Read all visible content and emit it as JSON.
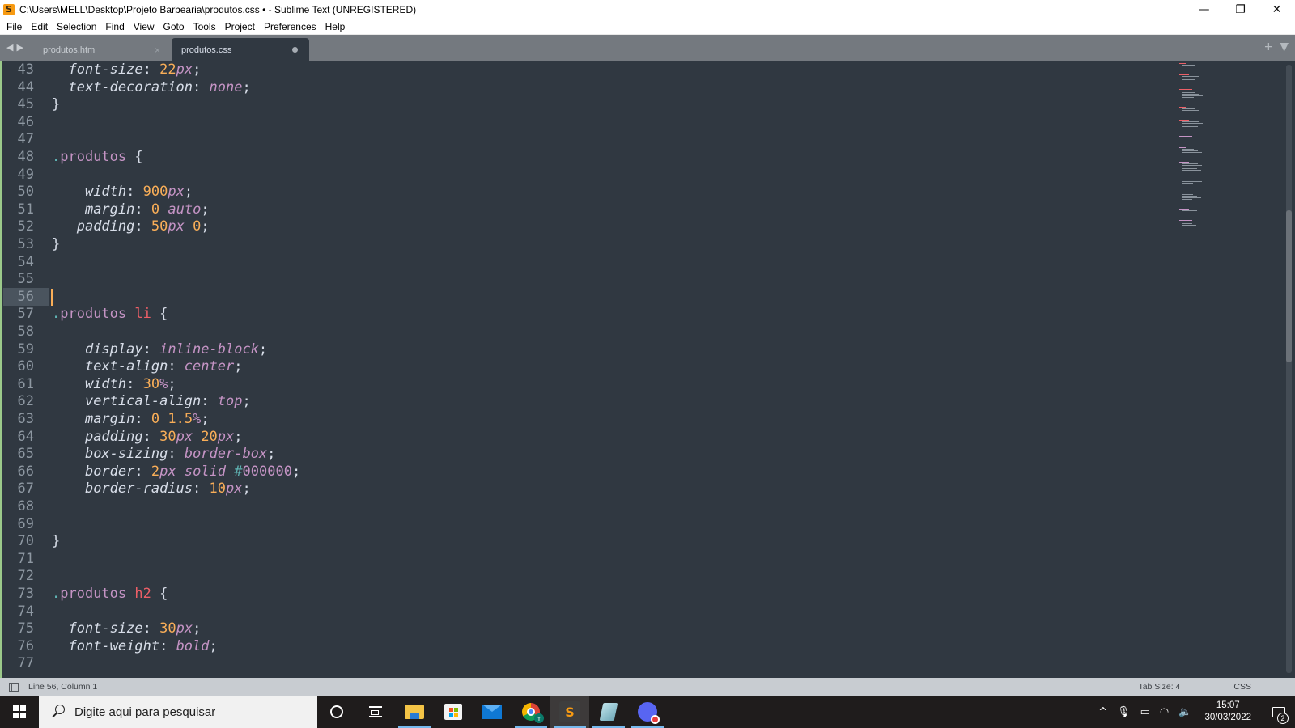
{
  "window": {
    "title": "C:\\Users\\MELL\\Desktop\\Projeto Barbearia\\produtos.css • - Sublime Text (UNREGISTERED)",
    "app_icon_glyph": "S",
    "controls": {
      "minimize": "—",
      "restore": "❐",
      "close": "✕"
    }
  },
  "menu": [
    "File",
    "Edit",
    "Selection",
    "Find",
    "View",
    "Goto",
    "Tools",
    "Project",
    "Preferences",
    "Help"
  ],
  "tabs": {
    "nav_prev": "◀",
    "nav_next": "▶",
    "items": [
      {
        "label": "produtos.html",
        "active": false,
        "close": "×"
      },
      {
        "label": "produtos.css",
        "active": true,
        "dirty": true
      }
    ],
    "new_tab": "+",
    "tab_menu": "▼"
  },
  "editor": {
    "current_line": 56,
    "scroll_position": 0.32,
    "scroll_visible_fraction": 0.25,
    "lines": [
      {
        "n": "43",
        "tokens": [
          [
            "sp",
            "  "
          ],
          [
            "prop",
            "font-size"
          ],
          [
            "punc",
            ": "
          ],
          [
            "num",
            "22"
          ],
          [
            "unit",
            "px"
          ],
          [
            "punc",
            ";"
          ]
        ]
      },
      {
        "n": "44",
        "tokens": [
          [
            "sp",
            "  "
          ],
          [
            "prop",
            "text-decoration"
          ],
          [
            "punc",
            ": "
          ],
          [
            "kw",
            "none"
          ],
          [
            "punc",
            ";"
          ]
        ]
      },
      {
        "n": "45",
        "tokens": [
          [
            "punc",
            "}"
          ]
        ]
      },
      {
        "n": "46",
        "tokens": []
      },
      {
        "n": "47",
        "tokens": []
      },
      {
        "n": "48",
        "tokens": [
          [
            "dot",
            "."
          ],
          [
            "sel",
            "produtos"
          ],
          [
            "punc",
            " {"
          ]
        ]
      },
      {
        "n": "49",
        "tokens": []
      },
      {
        "n": "50",
        "tokens": [
          [
            "sp",
            "    "
          ],
          [
            "prop",
            "width"
          ],
          [
            "punc",
            ": "
          ],
          [
            "num",
            "900"
          ],
          [
            "unit",
            "px"
          ],
          [
            "punc",
            ";"
          ]
        ]
      },
      {
        "n": "51",
        "tokens": [
          [
            "sp",
            "    "
          ],
          [
            "prop",
            "margin"
          ],
          [
            "punc",
            ": "
          ],
          [
            "num",
            "0"
          ],
          [
            "punc",
            " "
          ],
          [
            "kw",
            "auto"
          ],
          [
            "punc",
            ";"
          ]
        ]
      },
      {
        "n": "52",
        "tokens": [
          [
            "sp",
            "   "
          ],
          [
            "prop",
            "padding"
          ],
          [
            "punc",
            ": "
          ],
          [
            "num",
            "50"
          ],
          [
            "unit",
            "px"
          ],
          [
            "punc",
            " "
          ],
          [
            "num",
            "0"
          ],
          [
            "punc",
            ";"
          ]
        ]
      },
      {
        "n": "53",
        "tokens": [
          [
            "punc",
            "}"
          ]
        ]
      },
      {
        "n": "54",
        "tokens": []
      },
      {
        "n": "55",
        "tokens": []
      },
      {
        "n": "56",
        "tokens": [],
        "current": true
      },
      {
        "n": "57",
        "tokens": [
          [
            "dot",
            "."
          ],
          [
            "sel",
            "produtos"
          ],
          [
            "punc",
            " "
          ],
          [
            "tag",
            "li"
          ],
          [
            "punc",
            " {"
          ]
        ]
      },
      {
        "n": "58",
        "tokens": []
      },
      {
        "n": "59",
        "tokens": [
          [
            "sp",
            "    "
          ],
          [
            "prop",
            "display"
          ],
          [
            "punc",
            ": "
          ],
          [
            "kw",
            "inline-block"
          ],
          [
            "punc",
            ";"
          ]
        ]
      },
      {
        "n": "60",
        "tokens": [
          [
            "sp",
            "    "
          ],
          [
            "prop",
            "text-align"
          ],
          [
            "punc",
            ": "
          ],
          [
            "kw",
            "center"
          ],
          [
            "punc",
            ";"
          ]
        ]
      },
      {
        "n": "61",
        "tokens": [
          [
            "sp",
            "    "
          ],
          [
            "prop",
            "width"
          ],
          [
            "punc",
            ": "
          ],
          [
            "num",
            "30"
          ],
          [
            "unit",
            "%"
          ],
          [
            "punc",
            ";"
          ]
        ]
      },
      {
        "n": "62",
        "tokens": [
          [
            "sp",
            "    "
          ],
          [
            "prop",
            "vertical-align"
          ],
          [
            "punc",
            ": "
          ],
          [
            "kw",
            "top"
          ],
          [
            "punc",
            ";"
          ]
        ]
      },
      {
        "n": "63",
        "tokens": [
          [
            "sp",
            "    "
          ],
          [
            "prop",
            "margin"
          ],
          [
            "punc",
            ": "
          ],
          [
            "num",
            "0"
          ],
          [
            "punc",
            " "
          ],
          [
            "num",
            "1.5"
          ],
          [
            "unit",
            "%"
          ],
          [
            "punc",
            ";"
          ]
        ]
      },
      {
        "n": "64",
        "tokens": [
          [
            "sp",
            "    "
          ],
          [
            "prop",
            "padding"
          ],
          [
            "punc",
            ": "
          ],
          [
            "num",
            "30"
          ],
          [
            "unit",
            "px"
          ],
          [
            "punc",
            " "
          ],
          [
            "num",
            "20"
          ],
          [
            "unit",
            "px"
          ],
          [
            "punc",
            ";"
          ]
        ]
      },
      {
        "n": "65",
        "tokens": [
          [
            "sp",
            "    "
          ],
          [
            "prop",
            "box-sizing"
          ],
          [
            "punc",
            ": "
          ],
          [
            "kw",
            "border-box"
          ],
          [
            "punc",
            ";"
          ]
        ]
      },
      {
        "n": "66",
        "tokens": [
          [
            "sp",
            "    "
          ],
          [
            "prop",
            "border"
          ],
          [
            "punc",
            ": "
          ],
          [
            "num",
            "2"
          ],
          [
            "unit",
            "px"
          ],
          [
            "punc",
            " "
          ],
          [
            "kw",
            "solid"
          ],
          [
            "punc",
            " "
          ],
          [
            "hash",
            "#"
          ],
          [
            "hex",
            "000000"
          ],
          [
            "punc",
            ";"
          ]
        ]
      },
      {
        "n": "67",
        "tokens": [
          [
            "sp",
            "    "
          ],
          [
            "prop",
            "border-radius"
          ],
          [
            "punc",
            ": "
          ],
          [
            "num",
            "10"
          ],
          [
            "unit",
            "px"
          ],
          [
            "punc",
            ";"
          ]
        ]
      },
      {
        "n": "68",
        "tokens": []
      },
      {
        "n": "69",
        "tokens": []
      },
      {
        "n": "70",
        "tokens": [
          [
            "punc",
            "}"
          ]
        ]
      },
      {
        "n": "71",
        "tokens": []
      },
      {
        "n": "72",
        "tokens": []
      },
      {
        "n": "73",
        "tokens": [
          [
            "dot",
            "."
          ],
          [
            "sel",
            "produtos"
          ],
          [
            "punc",
            " "
          ],
          [
            "tag",
            "h2"
          ],
          [
            "punc",
            " {"
          ]
        ]
      },
      {
        "n": "74",
        "tokens": []
      },
      {
        "n": "75",
        "tokens": [
          [
            "sp",
            "  "
          ],
          [
            "prop",
            "font-size"
          ],
          [
            "punc",
            ": "
          ],
          [
            "num",
            "30"
          ],
          [
            "unit",
            "px"
          ],
          [
            "punc",
            ";"
          ]
        ]
      },
      {
        "n": "76",
        "tokens": [
          [
            "sp",
            "  "
          ],
          [
            "prop",
            "font-weight"
          ],
          [
            "punc",
            ": "
          ],
          [
            "kw",
            "bold"
          ],
          [
            "punc",
            ";"
          ]
        ]
      },
      {
        "n": "77",
        "tokens": []
      }
    ]
  },
  "statusbar": {
    "position": "Line 56, Column 1",
    "tab_size": "Tab Size: 4",
    "syntax": "CSS"
  },
  "taskbar": {
    "search_placeholder": "Digite aqui para pesquisar",
    "apps": [
      {
        "name": "cortana",
        "open": false
      },
      {
        "name": "task-view",
        "open": false
      },
      {
        "name": "file-explorer",
        "open": true
      },
      {
        "name": "microsoft-store",
        "open": false
      },
      {
        "name": "mail",
        "open": false
      },
      {
        "name": "chrome",
        "open": true,
        "badge": "m"
      },
      {
        "name": "sublime-text",
        "open": true,
        "active": true
      },
      {
        "name": "notepad",
        "open": true
      },
      {
        "name": "discord",
        "open": true
      }
    ],
    "tray": {
      "chevron": "^",
      "time": "15:07",
      "date": "30/03/2022",
      "notifications": "2"
    }
  },
  "colors": {
    "editor_bg": "#303841",
    "selector": "#c594c5",
    "tag": "#ec5f67",
    "number": "#f9ae58",
    "keyword": "#c594c5",
    "caret": "#f9ae58",
    "modified_marker": "#9bc98a"
  }
}
